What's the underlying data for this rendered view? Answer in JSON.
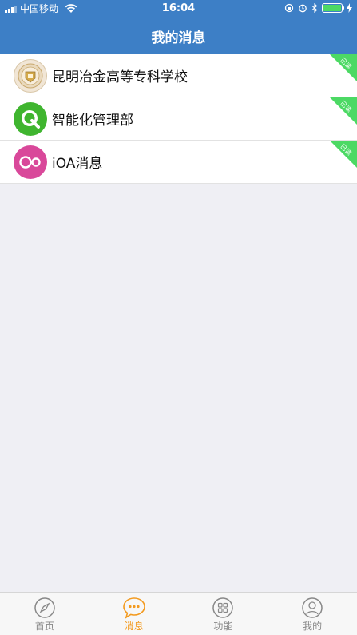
{
  "status_bar": {
    "carrier": "中国移动",
    "time": "16:04"
  },
  "nav": {
    "title": "我的消息"
  },
  "messages": [
    {
      "label": "昆明冶金高等专科学校",
      "badge": "已读",
      "icon": "school-crest-icon"
    },
    {
      "label": "智能化管理部",
      "badge": "已读",
      "icon": "green-q-icon"
    },
    {
      "label": "iOA消息",
      "badge": "已读",
      "icon": "ioa-icon"
    }
  ],
  "tabs": [
    {
      "label": "首页",
      "icon": "compass-icon",
      "active": false
    },
    {
      "label": "消息",
      "icon": "chat-bubble-icon",
      "active": true
    },
    {
      "label": "功能",
      "icon": "grid-icon",
      "active": false
    },
    {
      "label": "我的",
      "icon": "user-icon",
      "active": false
    }
  ],
  "colors": {
    "header": "#3d7fc6",
    "active_tab": "#f39a1e",
    "badge": "#4cd964"
  }
}
